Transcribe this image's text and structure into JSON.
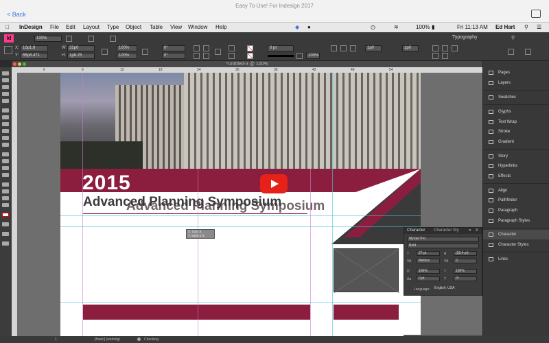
{
  "window": {
    "title": "Easy To Use! For Indesign 2017",
    "back_label": "< Back"
  },
  "menubar": {
    "items": [
      "InDesign",
      "File",
      "Edit",
      "Layout",
      "Type",
      "Object",
      "Table",
      "View",
      "Window",
      "Help"
    ],
    "status": {
      "battery": "100%",
      "clock": "Fri 11:13 AM",
      "user": "Ed Hart"
    }
  },
  "control_bar": {
    "zoom": "100%",
    "workspace": "Typography",
    "x_value": "10p1.8",
    "y_value": "55p8.471",
    "w_value": "32p0",
    "h_value": "1p8.25",
    "scale_x": "100%",
    "scale_y": "100%",
    "angle": "0°",
    "shear": "0°",
    "stroke_weight": "0 pt",
    "opacity": "100%",
    "columns": "1p0",
    "gutter": "1p0"
  },
  "document": {
    "tab_title": "*Untitled-3 @ 100%",
    "ruler_ticks": [
      "0",
      "6",
      "12",
      "18",
      "24",
      "30",
      "36",
      "42",
      "48",
      "54"
    ],
    "year_text": "2015",
    "heading_text": "Advanced Planning Symposium",
    "heading_ghost_text": "Advanced Planning Symposium",
    "tooltip_line1": "X: 10p1.8",
    "tooltip_line2": "Y: 55p8.471"
  },
  "status_bar": {
    "page": "1",
    "style": "[Basic] (working)",
    "preflight": "Checking"
  },
  "panels": {
    "items": [
      {
        "label": "Pages",
        "icon": "pages-icon"
      },
      {
        "label": "Layers",
        "icon": "layers-icon"
      },
      {
        "label": "Swatches",
        "icon": "swatches-icon"
      },
      {
        "label": "Glyphs",
        "icon": "glyphs-icon"
      },
      {
        "label": "Text Wrap",
        "icon": "text-wrap-icon"
      },
      {
        "label": "Stroke",
        "icon": "stroke-icon"
      },
      {
        "label": "Gradient",
        "icon": "gradient-icon"
      },
      {
        "label": "Story",
        "icon": "story-icon"
      },
      {
        "label": "Hyperlinks",
        "icon": "hyperlinks-icon"
      },
      {
        "label": "Effects",
        "icon": "effects-icon"
      },
      {
        "label": "Align",
        "icon": "align-icon"
      },
      {
        "label": "Pathfinder",
        "icon": "pathfinder-icon"
      },
      {
        "label": "Paragraph",
        "icon": "paragraph-icon"
      },
      {
        "label": "Paragraph Styles",
        "icon": "paragraph-styles-icon"
      },
      {
        "label": "Character",
        "icon": "character-icon"
      },
      {
        "label": "Character Styles",
        "icon": "character-styles-icon"
      },
      {
        "label": "Links",
        "icon": "links-icon"
      }
    ]
  },
  "character_panel": {
    "tab_character": "Character",
    "tab_character_styles": "Character Sty",
    "font_family": "Myriad Pro",
    "font_style": "Bold",
    "font_size": "27 pt",
    "leading": "(32.4 pt)",
    "kerning": "Metrics",
    "tracking": "0",
    "vertical_scale": "100%",
    "horizontal_scale": "100%",
    "baseline_shift": "0 pt",
    "skew": "0°",
    "language_label": "Language:",
    "language": "English: USA"
  },
  "colors": {
    "brand_red": "#8b1e3f",
    "youtube_red": "#e62117",
    "guide_cyan": "#46c4d6"
  }
}
